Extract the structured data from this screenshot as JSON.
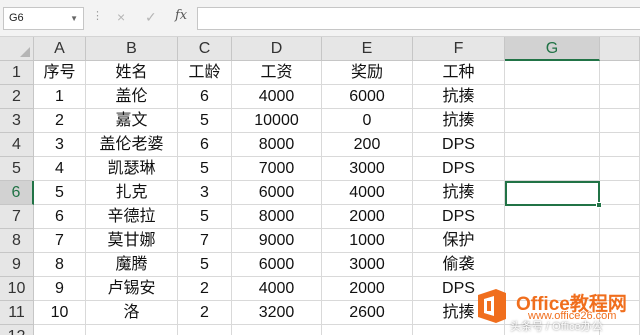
{
  "formula_bar": {
    "name_box": "G6",
    "cancel_icon": "×",
    "enter_icon": "✓",
    "fx_label": "fx",
    "formula": ""
  },
  "columns": [
    "A",
    "B",
    "C",
    "D",
    "E",
    "F",
    "G"
  ],
  "selected_column": "G",
  "rows": [
    "1",
    "2",
    "3",
    "4",
    "5",
    "6",
    "7",
    "8",
    "9",
    "10",
    "11",
    "12"
  ],
  "selected_row": "6",
  "selected_cell": "G6",
  "table": {
    "headers": [
      "序号",
      "姓名",
      "工龄",
      "工资",
      "奖励",
      "工种"
    ],
    "rows": [
      [
        "1",
        "盖伦",
        "6",
        "4000",
        "6000",
        "抗揍"
      ],
      [
        "2",
        "嘉文",
        "5",
        "10000",
        "0",
        "抗揍"
      ],
      [
        "3",
        "盖伦老婆",
        "6",
        "8000",
        "200",
        "DPS"
      ],
      [
        "4",
        "凯瑟琳",
        "5",
        "7000",
        "3000",
        "DPS"
      ],
      [
        "5",
        "扎克",
        "3",
        "6000",
        "4000",
        "抗揍"
      ],
      [
        "6",
        "辛德拉",
        "5",
        "8000",
        "2000",
        "DPS"
      ],
      [
        "7",
        "莫甘娜",
        "7",
        "9000",
        "1000",
        "保护"
      ],
      [
        "8",
        "魔腾",
        "5",
        "6000",
        "3000",
        "偷袭"
      ],
      [
        "9",
        "卢锡安",
        "2",
        "4000",
        "2000",
        "DPS"
      ],
      [
        "10",
        "洛",
        "2",
        "3200",
        "2600",
        "抗揍"
      ]
    ]
  },
  "watermark": {
    "brand": "Office教程网",
    "url": "www.office26.com",
    "credit": "头条号 / Office办公"
  },
  "colors": {
    "accent": "#217346",
    "watermark_orange": "#f06e1d"
  }
}
